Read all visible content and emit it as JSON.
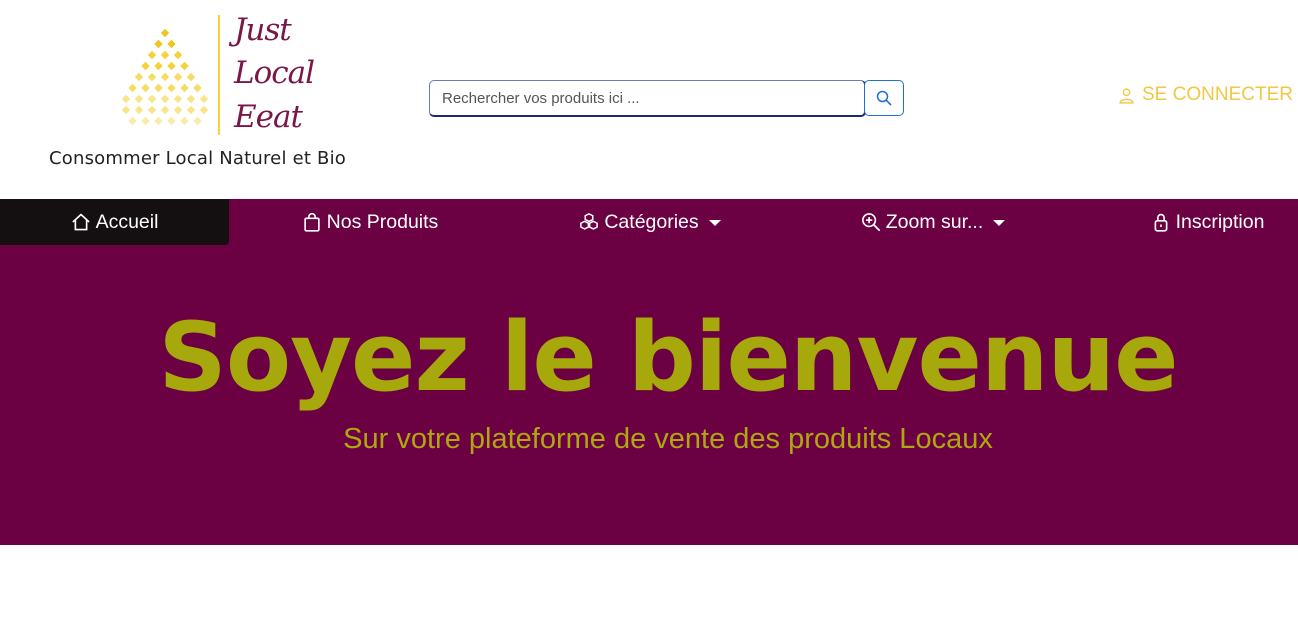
{
  "brand": {
    "name_lines": [
      "Just",
      "Local",
      "Eeat"
    ],
    "tagline": "Consommer Local Naturel et Bio",
    "colors": {
      "wordmark": "#7a1748",
      "mark": "#f3d23a"
    }
  },
  "search": {
    "placeholder": "Rechercher vos produits ici ...",
    "value": "",
    "button_icon": "search-icon"
  },
  "account": {
    "login_label": "SE CONNECTER",
    "login_icon": "user-icon",
    "color": "#f2c744"
  },
  "nav": {
    "items": [
      {
        "label": "Accueil",
        "icon": "home-icon",
        "active": true
      },
      {
        "label": "Nos Produits",
        "icon": "shopping-bag-icon"
      },
      {
        "label": "Catégories",
        "icon": "boxes-icon",
        "dropdown": true
      },
      {
        "label": "Zoom sur...",
        "icon": "zoom-in-icon",
        "dropdown": true
      },
      {
        "label": "Inscription",
        "icon": "lock-icon"
      }
    ],
    "background": "#6b0042",
    "active_background": "#141011"
  },
  "hero": {
    "title": "Soyez le bienvenue",
    "subtitle": "Sur votre plateforme de vente des produits Locaux",
    "background": "#6b0042",
    "text_color": "#a6a80c"
  }
}
